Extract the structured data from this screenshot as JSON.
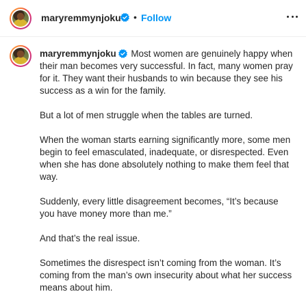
{
  "header": {
    "username": "maryremmynjoku",
    "separator": "•",
    "follow_label": "Follow"
  },
  "caption": {
    "username": "maryremmynjoku",
    "paragraphs": [
      "Most women are genuinely happy when their man becomes very successful. In fact, many women pray for it. They want their husbands to win because they see his success as a win for the family.",
      "But a lot of men struggle when the tables are turned.",
      "When the woman starts earning significantly more, some men begin to feel emasculated, inadequate, or disrespected. Even when she has done absolutely nothing to make them feel that way.",
      "Suddenly, every little disagreement becomes, “It’s because you have money more than me.”",
      "And that’s the real issue.",
      "Sometimes the disrespect isn’t coming from the woman. It’s coming from the man’s own insecurity about what her success means about him."
    ]
  },
  "icons": {
    "verified": "verified-badge-icon",
    "more": "more-options-icon"
  },
  "colors": {
    "text": "#262626",
    "follow": "#0095f6",
    "verified": "#0095f6"
  }
}
